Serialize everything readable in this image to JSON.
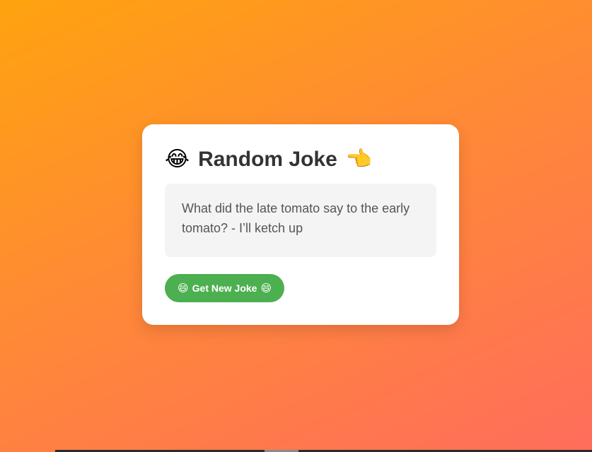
{
  "card": {
    "title_emoji_left": "😂",
    "title": "Random Joke",
    "title_emoji_right": "👈",
    "joke_text": "What did the late tomato say to the early tomato? - I’ll ketch up",
    "button": {
      "emoji_left": "😄",
      "label": "Get New Joke",
      "emoji_right": "😄"
    }
  },
  "colors": {
    "background_gradient_start": "#ffa30f",
    "background_gradient_end": "#ff6d5c",
    "card_background": "#ffffff",
    "joke_box_background": "#f4f4f4",
    "button_background": "#4caf50",
    "title_color": "#333333",
    "joke_text_color": "#555555"
  }
}
